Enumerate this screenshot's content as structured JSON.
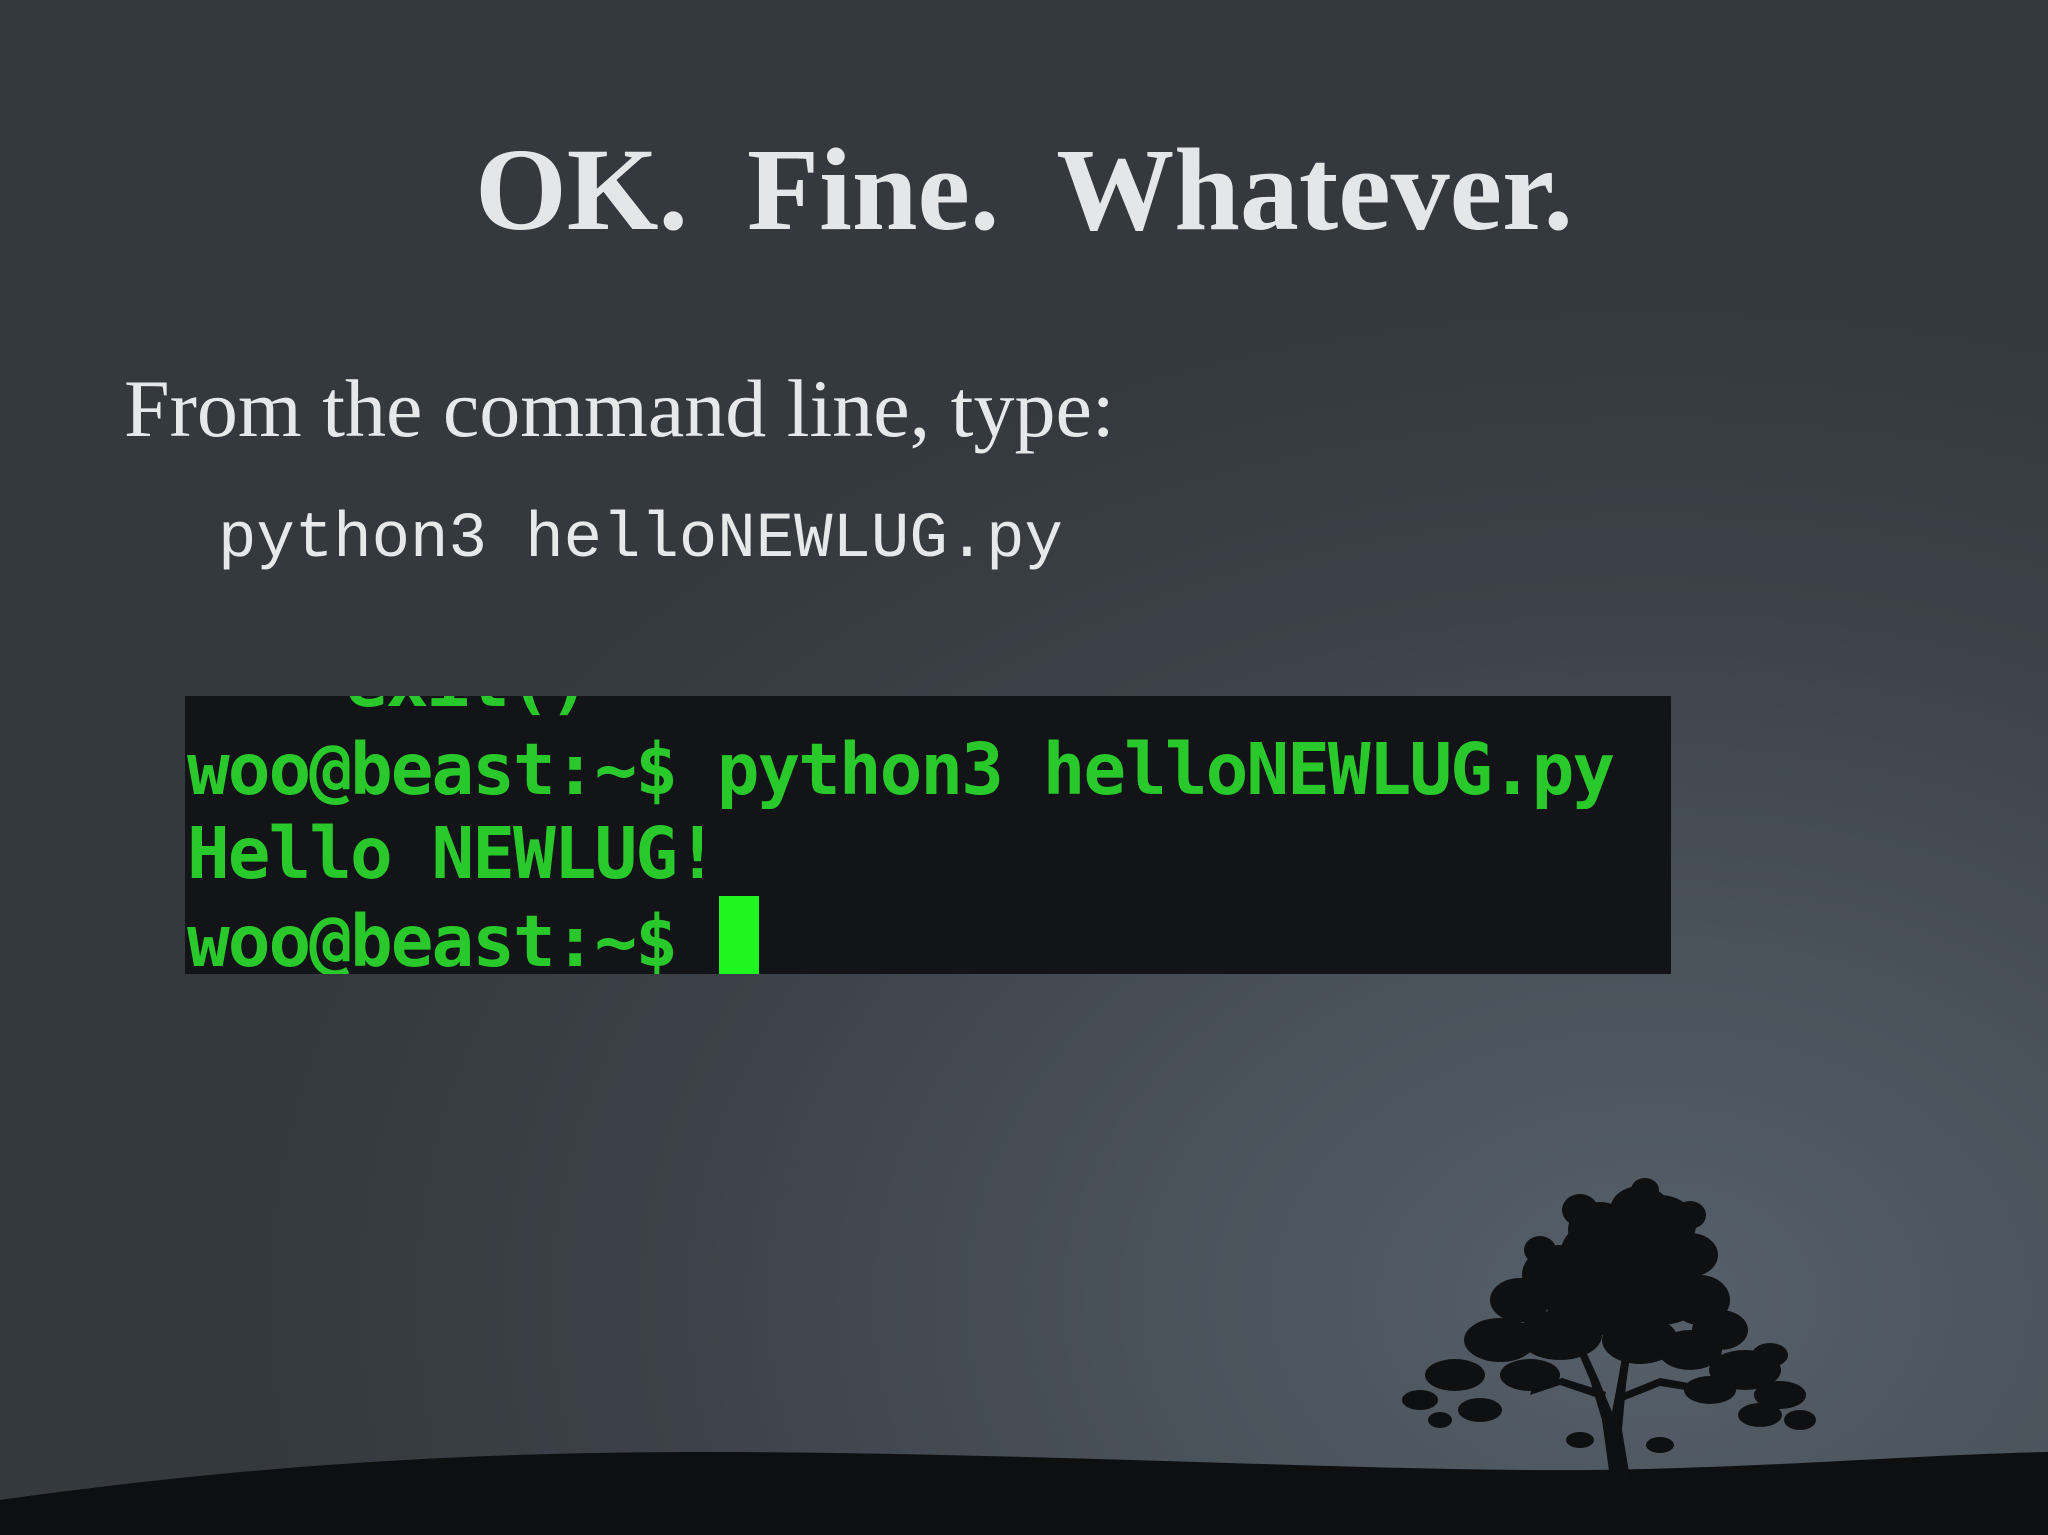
{
  "slide": {
    "title": "OK.  Fine.  Whatever.",
    "body": "From the command line, type:",
    "command": "python3 helloNEWLUG.py"
  },
  "terminal": {
    "cut_line": "exit()",
    "lines": [
      "woo@beast:~$ python3 helloNEWLUG.py",
      "Hello NEWLUG!",
      "woo@beast:~$ "
    ],
    "text_color": "#29c92b",
    "cursor_color": "#1ff51f",
    "background": "#121417"
  },
  "decoration": {
    "icon": "tree-silhouette-icon"
  }
}
